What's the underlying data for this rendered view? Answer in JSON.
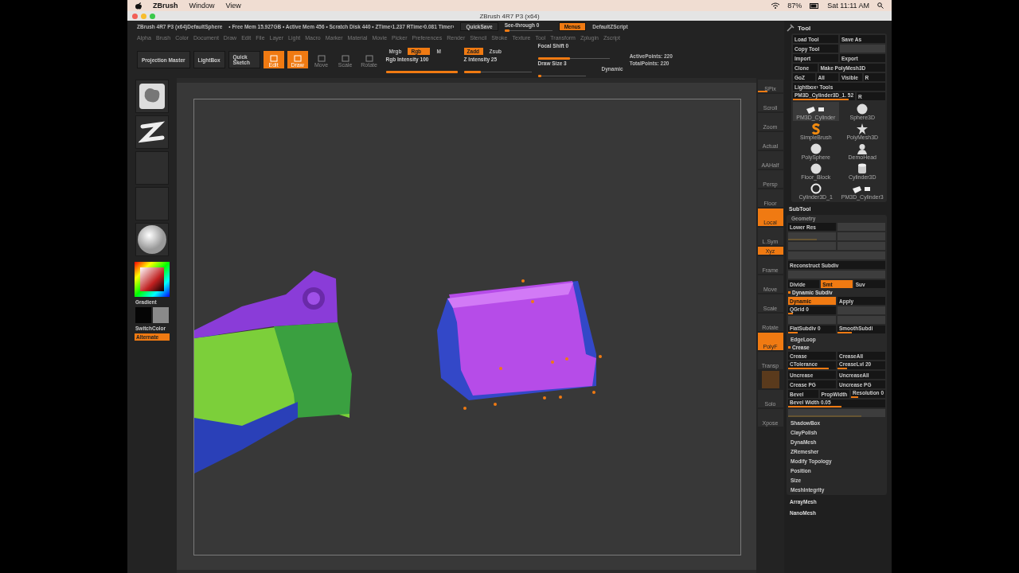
{
  "mac_menu": {
    "items": [
      "ZBrush",
      "Window",
      "View"
    ],
    "battery": "87%",
    "clock": "Sat 11:11 AM"
  },
  "window": {
    "title": "ZBrush 4R7 P3 (x64)"
  },
  "info_bar": {
    "document": "ZBrush 4R7 P3 (x64)DefaultSphere",
    "stats": "• Free Mem 15.927GB • Active Mem 456 • Scratch Disk 440 • ZTime›1.237 RTime›0.081 Timer›",
    "quicksave": "QuickSave",
    "see_through": {
      "label": "See-through 0",
      "level": 0.05
    },
    "menus": {
      "label": "Menus",
      "on": true
    },
    "script": "DefaultZScript"
  },
  "menu_bar": [
    "Alpha",
    "Brush",
    "Color",
    "Document",
    "Draw",
    "Edit",
    "File",
    "Layer",
    "Light",
    "Macro",
    "Marker",
    "Material",
    "Movie",
    "Picker",
    "Preferences",
    "Render",
    "Stencil",
    "Stroke",
    "Texture",
    "Tool",
    "Transform",
    "Zplugin",
    "Zscript"
  ],
  "top_shelf": {
    "projection_master": "Projection Master",
    "lightbox": "LightBox",
    "quick_sketch": "Quick Sketch",
    "modes": [
      {
        "label": "Edit",
        "on": true
      },
      {
        "label": "Draw",
        "on": true
      },
      {
        "label": "Move",
        "on": false
      },
      {
        "label": "Scale",
        "on": false
      },
      {
        "label": "Rotate",
        "on": false
      }
    ],
    "color_modes": [
      {
        "label": "Mrgb",
        "on": false
      },
      {
        "label": "Rgb",
        "on": true
      },
      {
        "label": "M",
        "on": false
      }
    ],
    "z_modes": [
      {
        "label": "Zadd",
        "on": true
      },
      {
        "label": "Zsub",
        "on": false
      }
    ],
    "sliders": [
      {
        "label": "Rgb Intensity 100",
        "level": 1
      },
      {
        "label": "Z Intensity 25",
        "level": 0.25
      },
      {
        "label": "Focal Shift 0",
        "level": 0.45
      },
      {
        "label": "Draw Size 3",
        "level": 0.05
      }
    ],
    "dynamic": "Dynamic",
    "active_points": "ActivePoints: 220",
    "total_points": "TotalPoints: 220"
  },
  "left_shelf": {
    "thumbnails": [
      {
        "kind": "brush"
      },
      {
        "kind": "stroke"
      },
      {
        "kind": "alpha"
      },
      {
        "kind": "texture"
      },
      {
        "kind": "material"
      }
    ],
    "gradient": "Gradient",
    "switch_color": "SwitchColor",
    "alternate": {
      "label": "Alternate",
      "on": true
    }
  },
  "right_shelf": [
    {
      "label": "SPix",
      "kind": "slider",
      "level": 0.4
    },
    {
      "label": "Scroll",
      "on": false
    },
    {
      "label": "Zoom",
      "on": false
    },
    {
      "label": "Actual",
      "on": false
    },
    {
      "label": "AAHalf",
      "on": false
    },
    {
      "label": "Persp",
      "on": false
    },
    {
      "label": "Floor",
      "on": false
    },
    {
      "label": "Local",
      "on": true
    },
    {
      "label": "L.Sym",
      "on": false
    },
    {
      "label": "Xyz",
      "kind": "small",
      "on": true
    },
    {
      "label": "Frame",
      "on": false
    },
    {
      "label": "Move",
      "on": false
    },
    {
      "label": "Scale",
      "on": false
    },
    {
      "label": "Rotate",
      "on": false
    },
    {
      "label": "PolyF",
      "on": true
    },
    {
      "label": "Transp",
      "on": false
    },
    {
      "kind": "ghost"
    },
    {
      "label": "Solo",
      "on": false
    },
    {
      "label": "Xpose",
      "on": false
    }
  ],
  "tool_palette": {
    "title": "Tool",
    "button_rows": [
      [
        {
          "label": "Load Tool"
        },
        {
          "label": "Save As"
        }
      ],
      [
        {
          "label": "Copy Tool"
        },
        {
          "disabled": true
        }
      ],
      [
        {
          "label": "Import"
        },
        {
          "label": "Export"
        }
      ],
      [
        {
          "label": "Clone"
        },
        {
          "label": "Make PolyMesh3D"
        }
      ],
      [
        {
          "label": "GoZ"
        },
        {
          "label": "All"
        },
        {
          "label": "Visible"
        },
        {
          "label": "R"
        }
      ],
      [
        {
          "label": "Lightbox› Tools"
        }
      ],
      [
        {
          "label": "PM3D_Cylinder3D_1. 52",
          "kind": "slider",
          "level": 0.9
        },
        {
          "label": "R"
        }
      ]
    ],
    "tools": [
      {
        "label": "PM3D_Cylinder",
        "kind": "mesh",
        "selected": true
      },
      {
        "label": "Sphere3D",
        "kind": "sphere",
        "selected": false
      },
      {
        "label": "SimpleBrush",
        "kind": "brush",
        "selected": false
      },
      {
        "label": "PolyMesh3D",
        "kind": "star",
        "selected": false
      },
      {
        "label": "PolySphere",
        "kind": "sphere",
        "selected": false
      },
      {
        "label": "DemoHead",
        "kind": "head",
        "selected": false
      },
      {
        "label": "Floor_Block",
        "kind": "sphere",
        "selected": false
      },
      {
        "label": "Cylinder3D",
        "kind": "cylinder",
        "selected": false
      },
      {
        "label": "Cylinder3D_1",
        "kind": "ring",
        "selected": false
      },
      {
        "label": "PM3D_Cylinder3",
        "kind": "mesh",
        "selected": false
      }
    ]
  },
  "subtool": {
    "title": "SubTool",
    "geometry": "Geometry",
    "rows": [
      {
        "kind": "cells",
        "cells": [
          {
            "kind": "button",
            "label": "Lower Res"
          },
          {
            "kind": "button",
            "disabled": true
          }
        ]
      },
      {
        "kind": "cells",
        "cells": [
          {
            "kind": "slider",
            "disabled": true,
            "level": 0.6
          },
          {
            "kind": "button",
            "disabled": true
          }
        ]
      },
      {
        "kind": "cells",
        "cells": [
          {
            "kind": "button",
            "disabled": true
          },
          {
            "kind": "button",
            "disabled": true
          }
        ]
      },
      {
        "kind": "cells",
        "cells": [
          {
            "kind": "button",
            "disabled": true
          }
        ]
      },
      {
        "kind": "cells",
        "cells": [
          {
            "kind": "button",
            "label": "Reconstruct Subdiv"
          }
        ]
      },
      {
        "kind": "cells",
        "cells": [
          {
            "kind": "button",
            "disabled": true
          }
        ]
      },
      {
        "kind": "cells",
        "cells": [
          {
            "kind": "button",
            "label": "Divide"
          },
          {
            "kind": "button",
            "label": "Smt",
            "on": true
          },
          {
            "kind": "button",
            "label": "Suv",
            "on": false
          }
        ]
      },
      {
        "kind": "section",
        "label": "Dynamic Subdiv"
      },
      {
        "kind": "cells",
        "cells": [
          {
            "kind": "button",
            "label": "Dynamic",
            "on": true
          },
          {
            "kind": "button",
            "label": "Apply",
            "on": false
          }
        ]
      },
      {
        "kind": "cells",
        "cells": [
          {
            "kind": "slider",
            "label": "QGrid 0",
            "level": 0.1
          },
          {
            "kind": "button",
            "disabled": true
          }
        ]
      },
      {
        "kind": "cells",
        "cells": [
          {
            "kind": "button",
            "disabled": true
          },
          {
            "kind": "button",
            "disabled": true
          }
        ]
      },
      {
        "kind": "cells",
        "cells": [
          {
            "kind": "slider",
            "label": "FlatSubdiv 0",
            "level": 0.2
          },
          {
            "kind": "slider",
            "label": "SmoothSubdi",
            "level": 0.3
          }
        ]
      },
      {
        "kind": "item",
        "label": "EdgeLoop"
      },
      {
        "kind": "section",
        "label": "Crease"
      },
      {
        "kind": "cells",
        "cells": [
          {
            "kind": "button",
            "label": "Crease"
          },
          {
            "kind": "button",
            "label": "CreaseAll"
          }
        ]
      },
      {
        "kind": "cells",
        "cells": [
          {
            "kind": "slider",
            "label": "CTolerance",
            "level": 0.85
          },
          {
            "kind": "slider",
            "label": "CreaseLvl 20",
            "level": 0.2
          }
        ]
      },
      {
        "kind": "cells",
        "cells": [
          {
            "kind": "button",
            "label": "Uncrease"
          },
          {
            "kind": "button",
            "label": "UncreaseAll"
          }
        ]
      },
      {
        "kind": "cells",
        "cells": [
          {
            "kind": "button",
            "label": "Crease PG"
          },
          {
            "kind": "button",
            "label": "Uncrease PG"
          }
        ]
      },
      {
        "kind": "cells",
        "cells": [
          {
            "kind": "button",
            "label": "Bevel"
          },
          {
            "kind": "button",
            "label": "PropWidth"
          },
          {
            "kind": "slider",
            "label": "Resolution 0",
            "level": 0.2
          }
        ]
      },
      {
        "kind": "cells",
        "cells": [
          {
            "kind": "slider",
            "label": "Bevel Width 0.05",
            "level": 0.55
          }
        ]
      },
      {
        "kind": "cells",
        "cells": [
          {
            "kind": "slider",
            "disabled": true,
            "level": 0.75
          }
        ]
      },
      {
        "kind": "item",
        "label": "ShadowBox"
      },
      {
        "kind": "item",
        "label": "ClayPolish"
      },
      {
        "kind": "item",
        "label": "DynaMesh"
      },
      {
        "kind": "item",
        "label": "ZRemesher"
      },
      {
        "kind": "item",
        "label": "Modify Topology"
      },
      {
        "kind": "item",
        "label": "Position"
      },
      {
        "kind": "item",
        "label": "Size"
      },
      {
        "kind": "item",
        "label": "MeshIntegrity"
      }
    ]
  },
  "palettes": [
    "ArrayMesh",
    "NanoMesh"
  ]
}
